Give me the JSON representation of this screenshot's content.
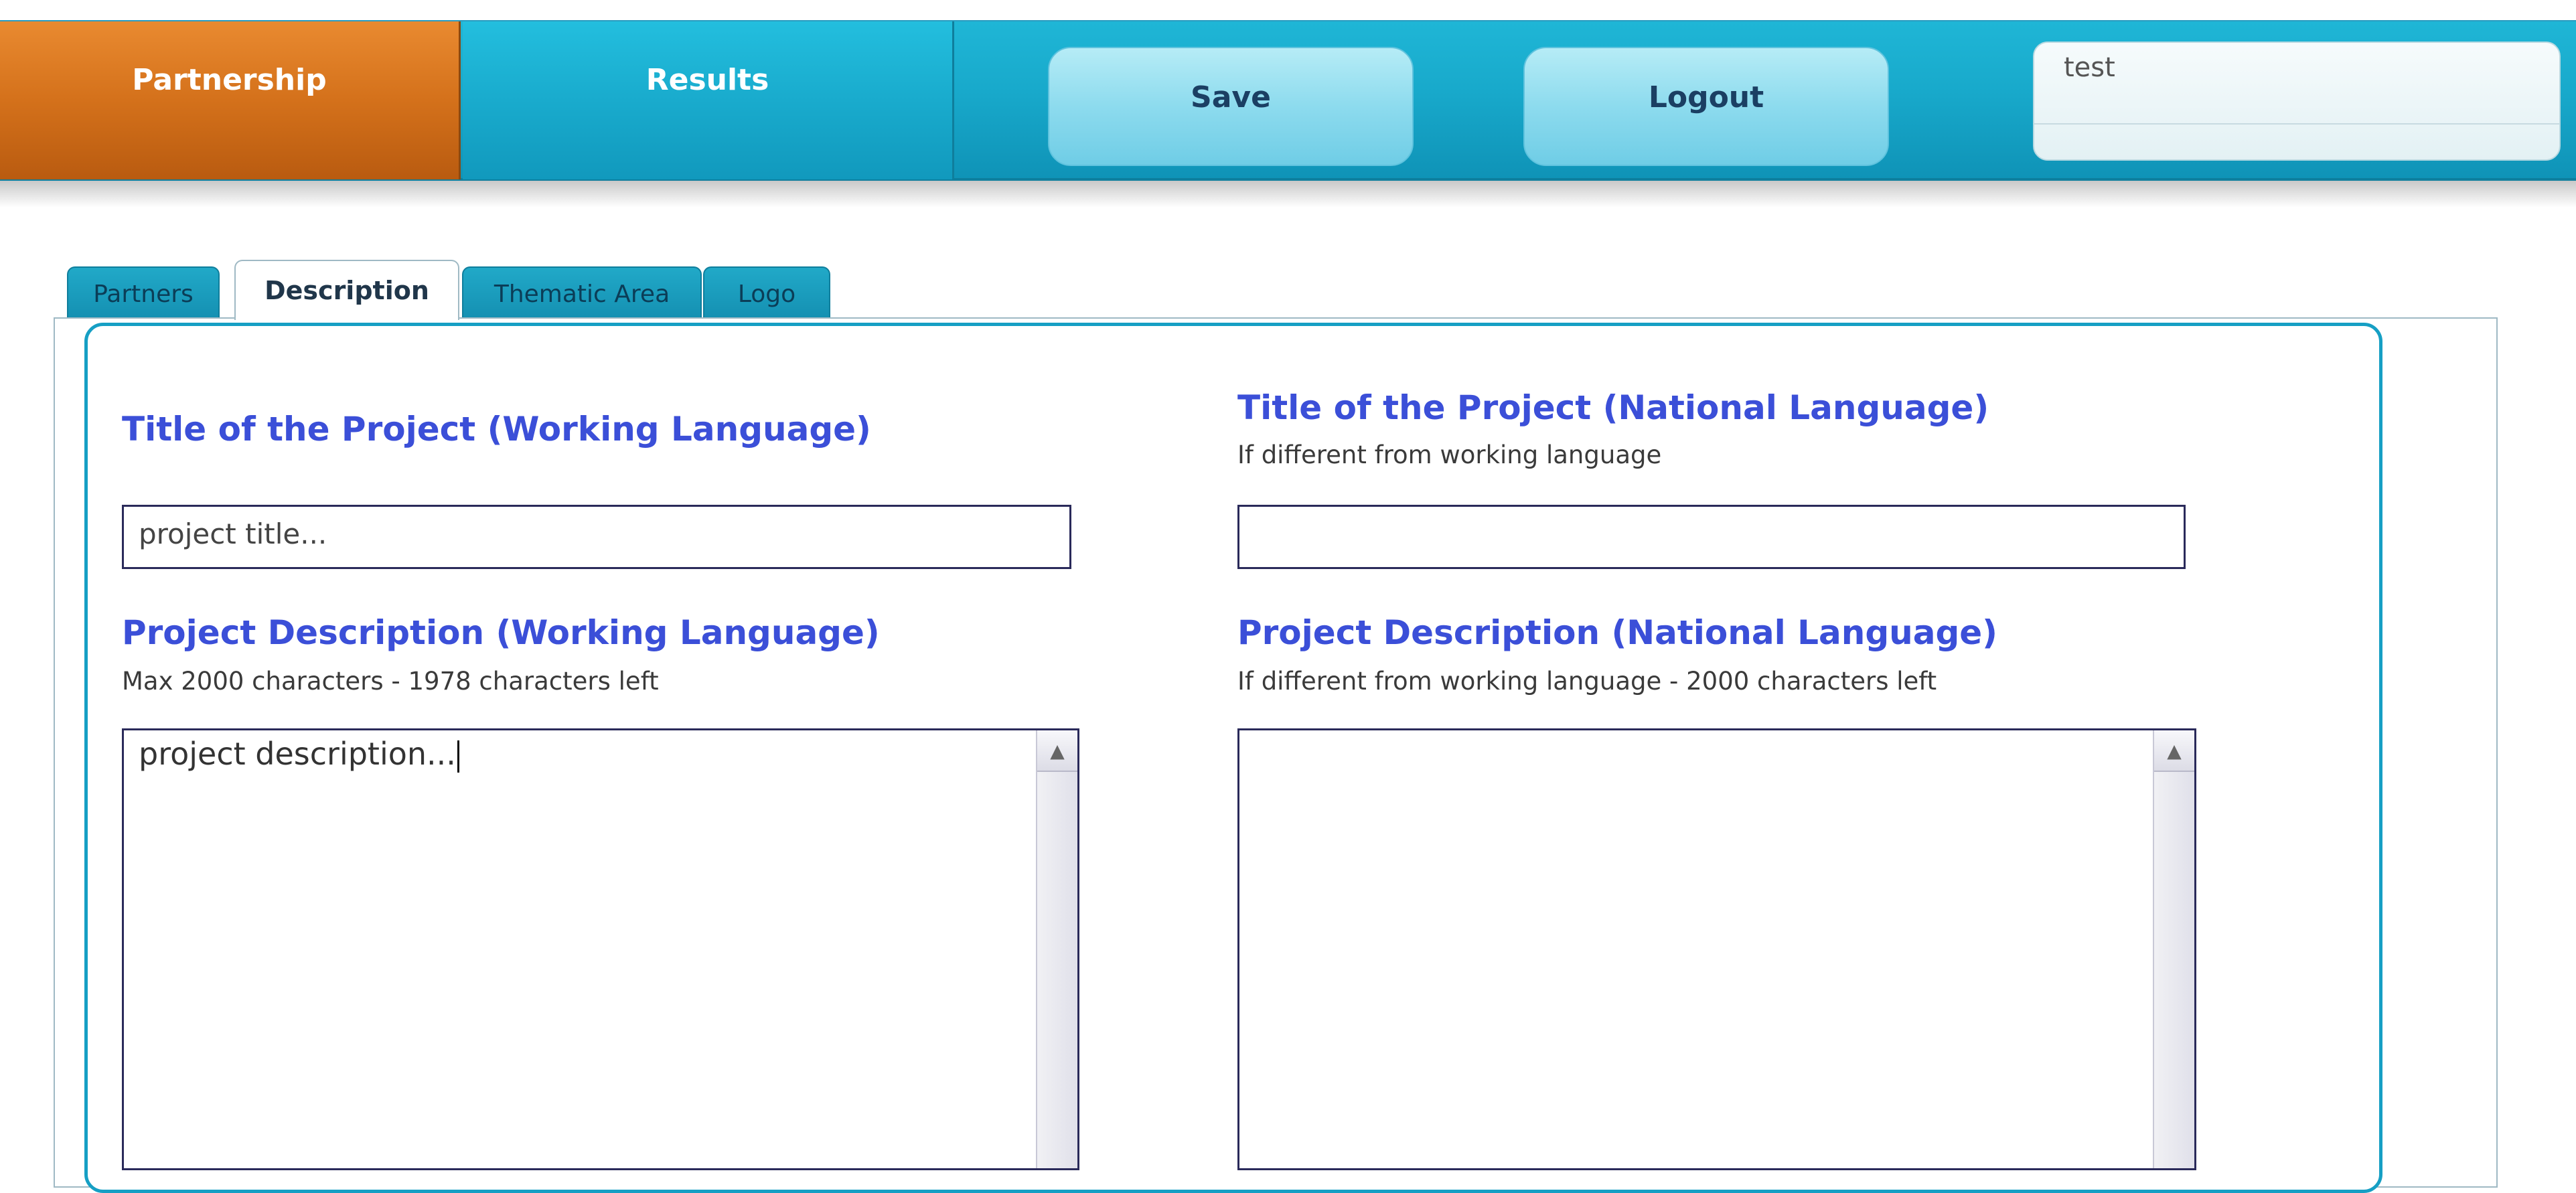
{
  "nav": {
    "partnership": "Partnership",
    "results": "Results",
    "save": "Save",
    "logout": "Logout",
    "user": "test"
  },
  "tabs": [
    "Partners",
    "Description",
    "Thematic Area",
    "Logo"
  ],
  "active_tab": "Description",
  "form": {
    "title_working": {
      "label": "Title of the Project (Working Language)",
      "value": "project title..."
    },
    "title_national": {
      "label": "Title of the Project (National Language)",
      "hint": "If different from working language",
      "value": ""
    },
    "desc_working": {
      "label": "Project Description (Working Language)",
      "hint": "Max 2000 characters - 1978 characters left",
      "value": "project description..."
    },
    "desc_national": {
      "label": "Project Description (National Language)",
      "hint": "If different from working language - 2000 characters left",
      "value": ""
    }
  },
  "colors": {
    "nav_teal": "#19abcd",
    "nav_orange": "#d4711b",
    "label_blue": "#3b4fd8",
    "panel_border": "#169fc4"
  },
  "icons": {
    "scroll_up": "scroll-up-arrow-icon"
  }
}
